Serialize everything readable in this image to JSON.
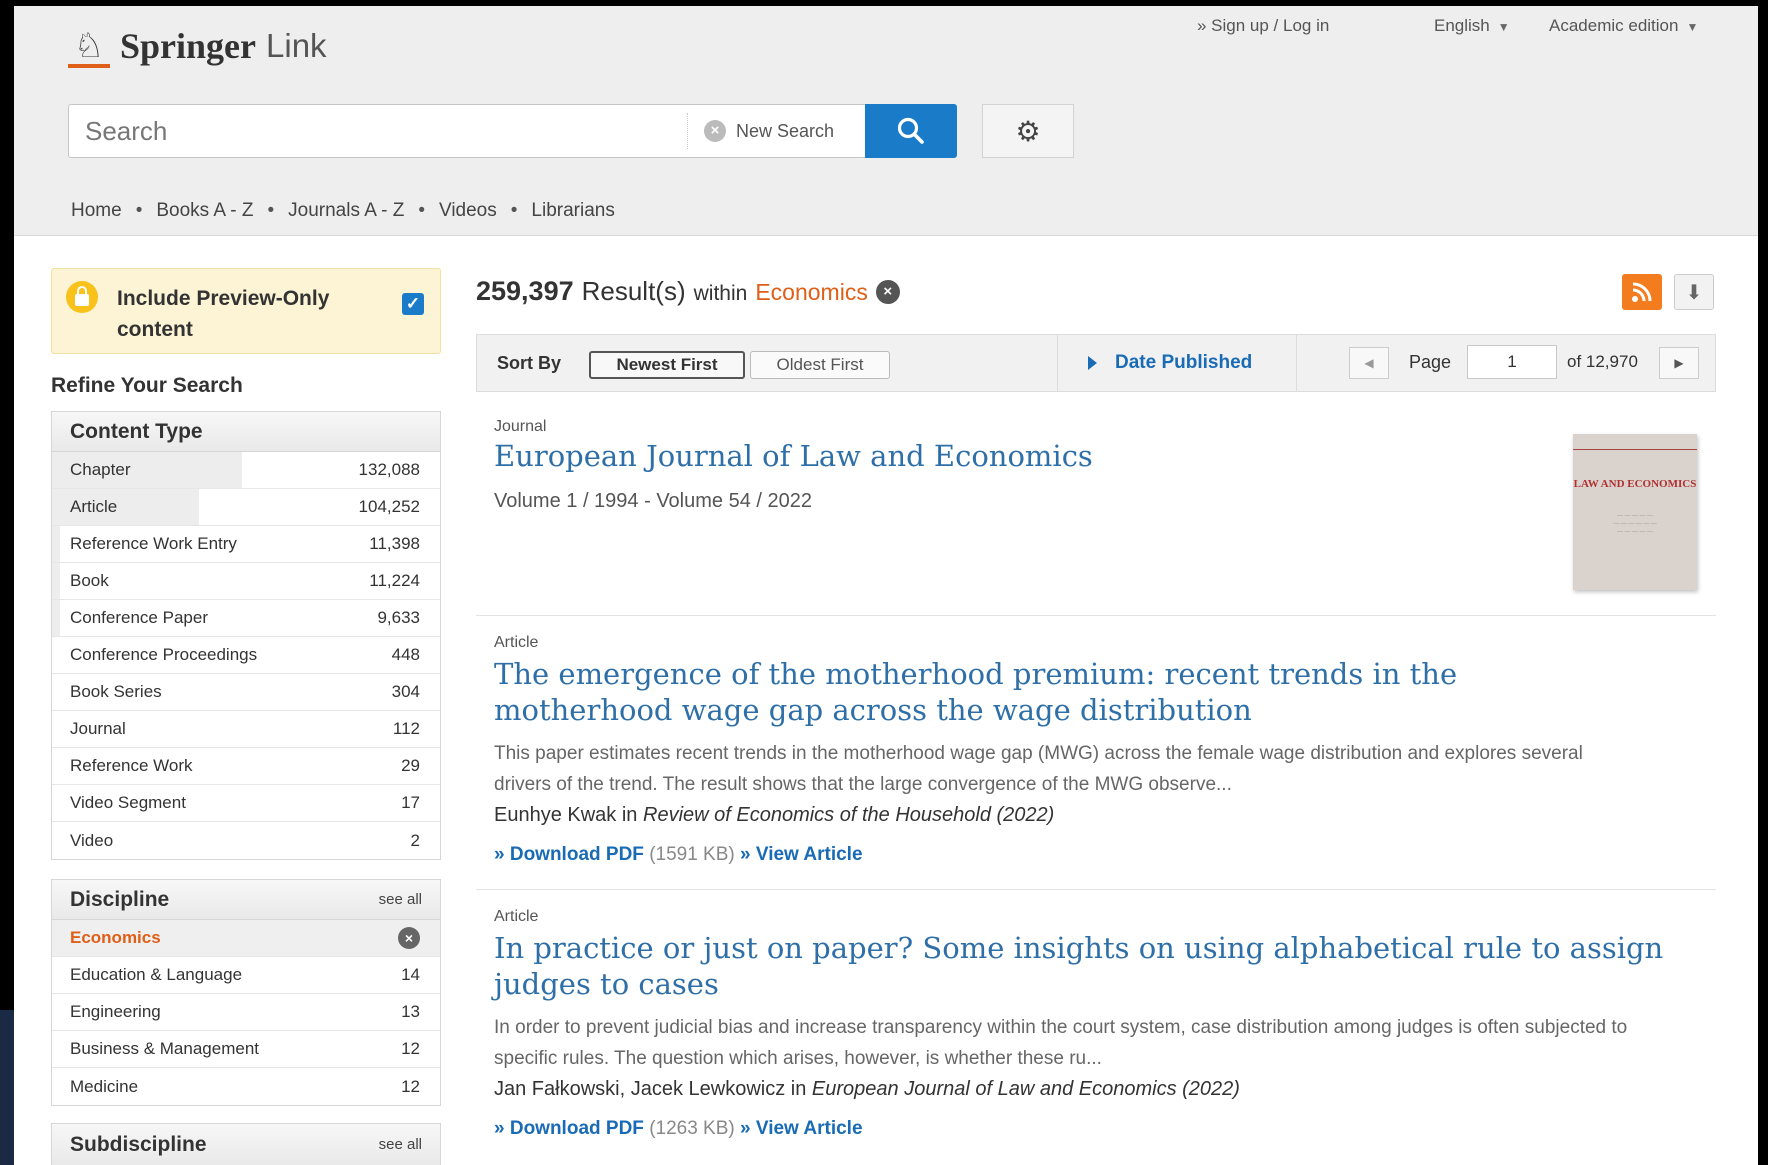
{
  "header": {
    "logo_bold": "Springer",
    "logo_light": "Link",
    "sign_up": "» Sign up / Log in",
    "language": "English",
    "edition": "Academic edition",
    "search_placeholder": "Search",
    "new_search": "New Search"
  },
  "nav": [
    "Home",
    "Books A - Z",
    "Journals A - Z",
    "Videos",
    "Librarians"
  ],
  "sidebar": {
    "preview_label": "Include Preview-Only content",
    "preview_checked": true,
    "refine_title": "Refine Your Search",
    "content_type": {
      "title": "Content Type",
      "items": [
        {
          "label": "Chapter",
          "count": "132,088",
          "share": 0.49
        },
        {
          "label": "Article",
          "count": "104,252",
          "share": 0.38
        },
        {
          "label": "Reference Work Entry",
          "count": "11,398",
          "share": 0.02
        },
        {
          "label": "Book",
          "count": "11,224",
          "share": 0.02
        },
        {
          "label": "Conference Paper",
          "count": "9,633",
          "share": 0.02
        },
        {
          "label": "Conference Proceedings",
          "count": "448",
          "share": 0
        },
        {
          "label": "Book Series",
          "count": "304",
          "share": 0
        },
        {
          "label": "Journal",
          "count": "112",
          "share": 0
        },
        {
          "label": "Reference Work",
          "count": "29",
          "share": 0
        },
        {
          "label": "Video Segment",
          "count": "17",
          "share": 0
        },
        {
          "label": "Video",
          "count": "2",
          "share": 0
        }
      ]
    },
    "discipline": {
      "title": "Discipline",
      "see_all": "see all",
      "selected": "Economics",
      "items": [
        {
          "label": "Education & Language",
          "count": "14"
        },
        {
          "label": "Engineering",
          "count": "13"
        },
        {
          "label": "Business & Management",
          "count": "12"
        },
        {
          "label": "Medicine",
          "count": "12"
        }
      ]
    },
    "subdiscipline": {
      "title": "Subdiscipline",
      "see_all": "see all"
    }
  },
  "results": {
    "count": "259,397",
    "result_word": "Result(s)",
    "within": "within",
    "discipline": "Economics",
    "sort_label": "Sort By",
    "sort_newest": "Newest First",
    "sort_oldest": "Oldest First",
    "date_published": "Date Published",
    "page_label": "Page",
    "page_value": "1",
    "page_of": "of 12,970",
    "items": [
      {
        "type": "Journal",
        "title": "European Journal of Law and Economics",
        "sub": "Volume 1 / 1994 - Volume 54 / 2022",
        "cover_title": "LAW AND ECONOMICS"
      },
      {
        "type": "Article",
        "title": "The emergence of the motherhood premium: recent trends in the motherhood wage gap across the wage distribution",
        "snippet": "This paper estimates recent trends in the motherhood wage gap (MWG) across the female wage distribution and explores several drivers of the trend. The result shows that the large convergence of the MWG observe...",
        "authors": "Eunhye Kwak",
        "in": "in",
        "source": "Review of Economics of the Household (2022)",
        "download": "» Download PDF",
        "size": "(1591 KB)",
        "view": "» View Article"
      },
      {
        "type": "Article",
        "title": "In practice or just on paper? Some insights on using alphabetical rule to assign judges to cases",
        "snippet": "In order to prevent judicial bias and increase transparency within the court system, case distribution among judges is often subjected to specific rules. The question which arises, however, is whether these ru...",
        "authors": "Jan Fałkowski, Jacek Lewkowicz",
        "in": "in",
        "source": "European Journal of Law and Economics (2022)",
        "download": "» Download PDF",
        "size": "(1263 KB)",
        "view": "» View Article"
      }
    ]
  }
}
